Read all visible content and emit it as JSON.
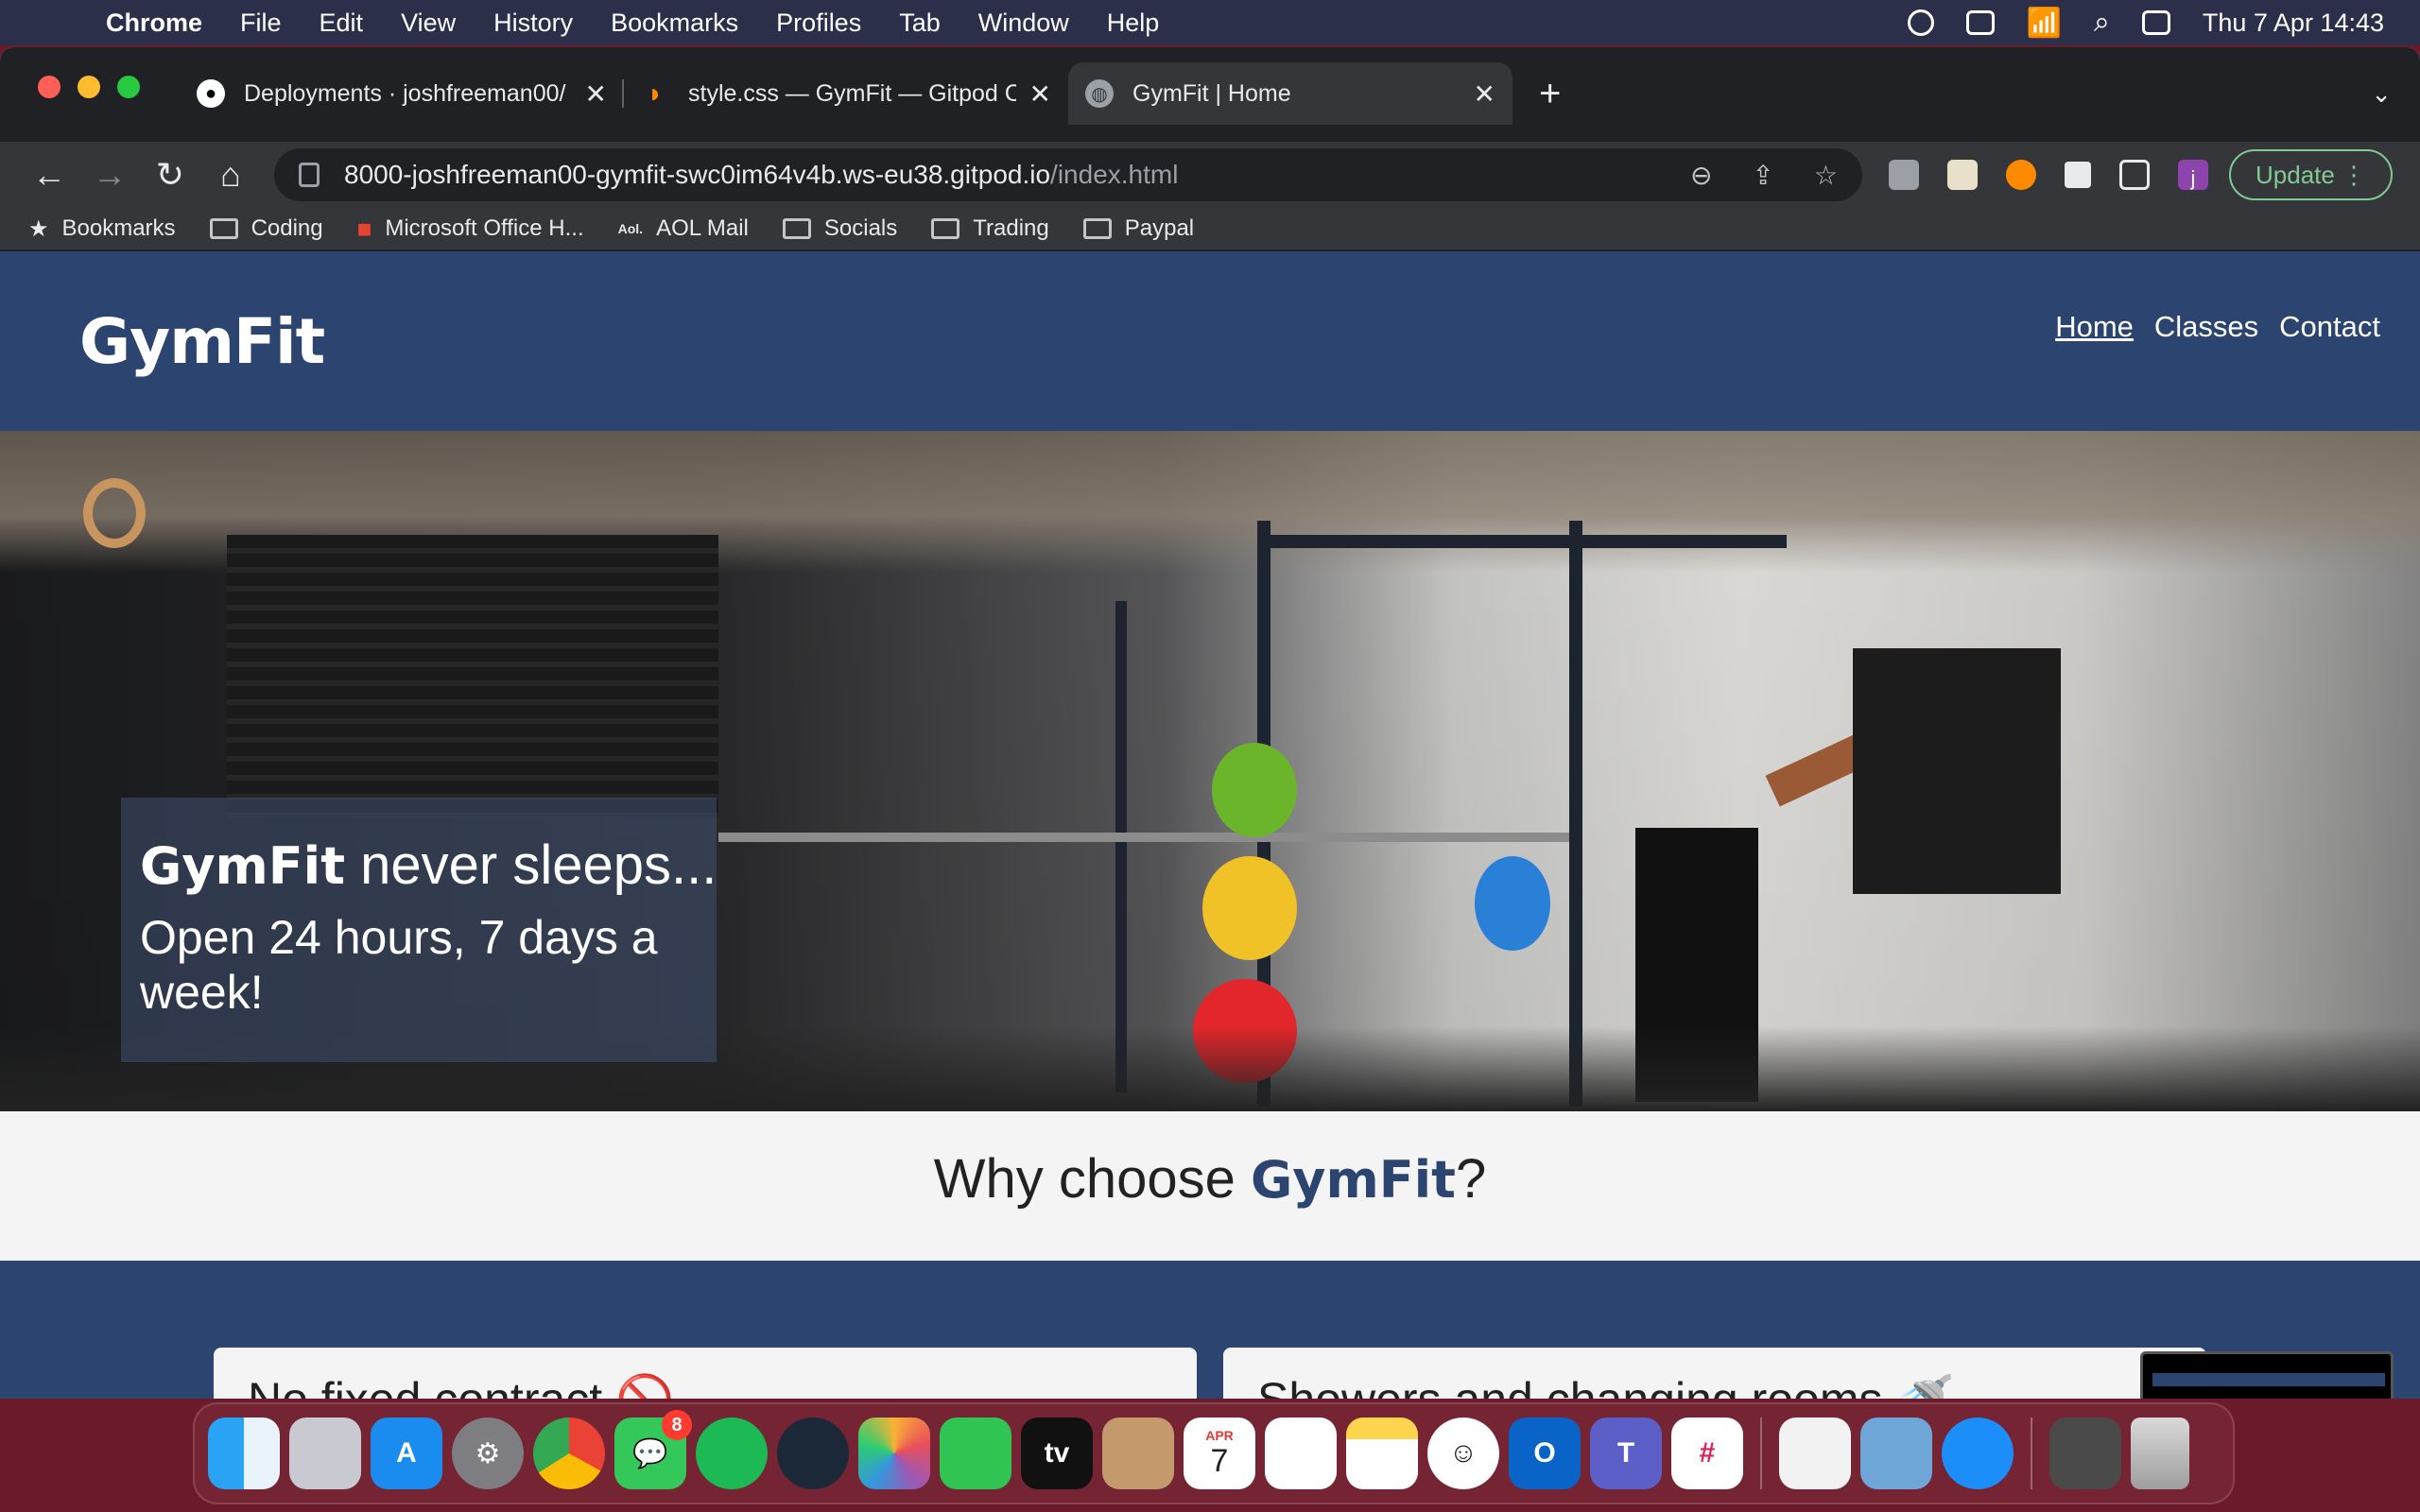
{
  "menubar": {
    "app_name": "Chrome",
    "items": [
      "File",
      "Edit",
      "View",
      "History",
      "Bookmarks",
      "Profiles",
      "Tab",
      "Window",
      "Help"
    ],
    "clock": "Thu 7 Apr  14:43"
  },
  "tabs": [
    {
      "title": "Deployments · joshfreeman00/",
      "icon": "github-icon"
    },
    {
      "title": "style.css — GymFit — Gitpod C",
      "icon": "gitpod-icon"
    },
    {
      "title": "GymFit | Home",
      "icon": "globe-icon"
    }
  ],
  "omnibox": {
    "host": "8000-joshfreeman00-gymfit-swc0im64v4b.ws-eu38.gitpod.io",
    "path": "/index.html"
  },
  "toolbar": {
    "profile_initial": "j",
    "update_label": "Update"
  },
  "bookmarks": [
    "Bookmarks",
    "Coding",
    "Microsoft Office H...",
    "AOL Mail",
    "Socials",
    "Trading",
    "Paypal"
  ],
  "site": {
    "logo": "GymFit",
    "nav": [
      "Home",
      "Classes",
      "Contact"
    ],
    "hero": {
      "brand": "GymFit",
      "line1_rest": " never sleeps...",
      "line2": "Open 24 hours, 7 days a week!"
    },
    "why": {
      "prefix": "Why choose ",
      "brand": "GymFit",
      "suffix": "?"
    },
    "features": [
      "No fixed contract 🚫",
      "Showers and changing rooms 🚿"
    ]
  },
  "dock": {
    "apps": [
      "Finder",
      "Launchpad",
      "App Store",
      "System Preferences",
      "Chrome",
      "Messages",
      "Spotify",
      "Steam",
      "Photos",
      "FaceTime",
      "TV",
      "Contacts",
      "Calendar",
      "Reminders",
      "Notes",
      "Memoji",
      "Outlook",
      "Teams",
      "Slack",
      "TextEdit",
      "Preview",
      "Safari",
      "Downloads",
      "Trash"
    ],
    "messages_badge": "8",
    "calendar_month": "APR",
    "calendar_day": "7",
    "tv_label": "tv"
  }
}
